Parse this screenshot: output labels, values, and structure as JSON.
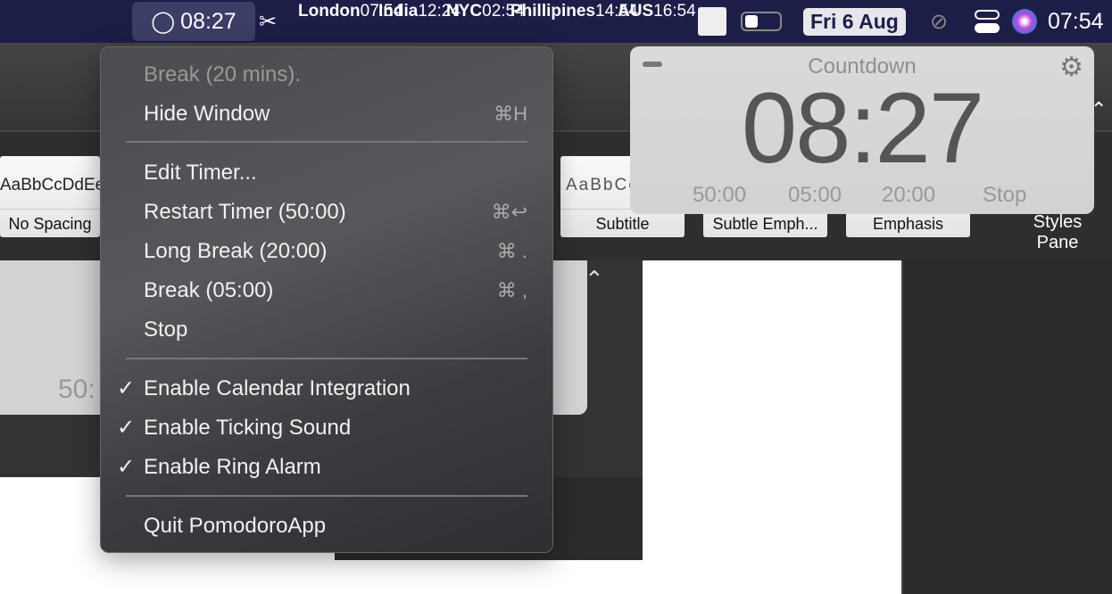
{
  "menubar": {
    "pomodoro_time": "08:27",
    "clocks": [
      {
        "city": "London",
        "time": "07:54"
      },
      {
        "city": "India",
        "time": "12:24"
      },
      {
        "city": "NYC",
        "time": "02:54"
      },
      {
        "city": "Phillipines",
        "time": "14:54"
      },
      {
        "city": "AUS",
        "time": "16:54"
      }
    ],
    "date": "Fri 6 Aug",
    "time": "07:54",
    "bg_color": "#1d1e48"
  },
  "ribbon": {
    "styles": [
      {
        "sample": "AaBbCcDdEe",
        "label": "No Spacing"
      },
      {
        "sample": "AaBbCc",
        "label": "Subtitle"
      },
      {
        "sample": "",
        "label": "Subtle Emph..."
      },
      {
        "sample": "",
        "label": "Emphasis"
      }
    ],
    "styles_pane": "Styles Pane"
  },
  "background_panel": {
    "partial_text": "50:"
  },
  "menu": {
    "status": "Break (20 mins).",
    "hide_window": {
      "label": "Hide Window",
      "shortcut": "⌘H"
    },
    "edit_timer": "Edit Timer...",
    "restart": {
      "label": "Restart Timer (50:00)",
      "shortcut": "⌘↩"
    },
    "long_break": {
      "label": "Long Break (20:00)",
      "shortcut": "⌘ ."
    },
    "break": {
      "label": "Break (05:00)",
      "shortcut": "⌘ ,"
    },
    "stop": "Stop",
    "calendar": {
      "label": "Enable Calendar Integration",
      "checked": true
    },
    "ticking": {
      "label": "Enable Ticking Sound",
      "checked": true
    },
    "ring": {
      "label": "Enable Ring Alarm",
      "checked": true
    },
    "quit": "Quit PomodoroApp",
    "check_glyph": "✓"
  },
  "countdown": {
    "title": "Countdown",
    "time": "08:27",
    "presets": [
      "50:00",
      "05:00",
      "20:00"
    ],
    "stop": "Stop"
  }
}
